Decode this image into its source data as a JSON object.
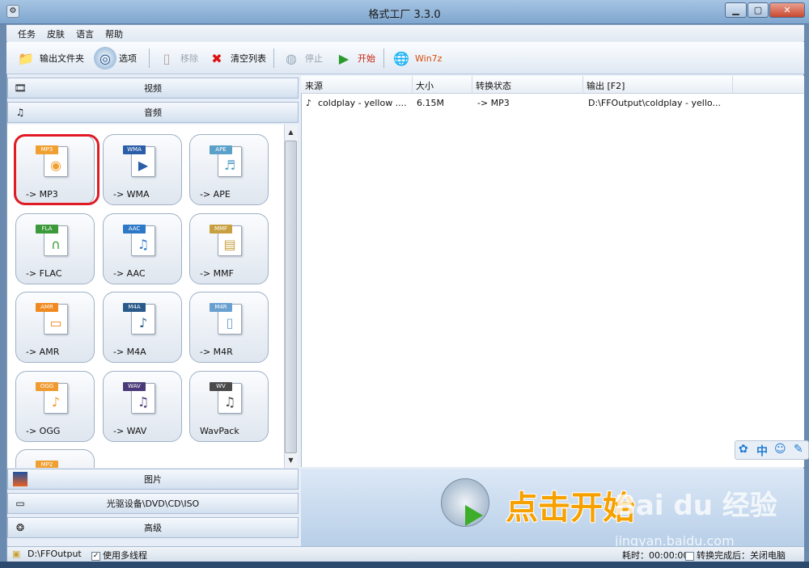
{
  "window": {
    "title": "格式工厂 3.3.0"
  },
  "menu": [
    "任务",
    "皮肤",
    "语言",
    "帮助"
  ],
  "toolbar": {
    "output_folder": "输出文件夹",
    "options": "选项",
    "remove": "移除",
    "clear_list": "清空列表",
    "stop": "停止",
    "start": "开始",
    "win7z": "Win7z"
  },
  "categories": {
    "video": "视频",
    "audio": "音频",
    "picture": "图片",
    "rom": "光驱设备\\DVD\\CD\\ISO",
    "advanced": "高级"
  },
  "formats": [
    {
      "tag": "MP3",
      "label": "-> MP3",
      "color": "#f0a030",
      "symbol": "◉"
    },
    {
      "tag": "WMA",
      "label": "-> WMA",
      "color": "#2a5ea8",
      "symbol": "▶"
    },
    {
      "tag": "APE",
      "label": "-> APE",
      "color": "#5aa0c8",
      "symbol": "♬"
    },
    {
      "tag": "FLA",
      "label": "-> FLAC",
      "color": "#3c9a3a",
      "symbol": "∩"
    },
    {
      "tag": "AAC",
      "label": "-> AAC",
      "color": "#2f78c8",
      "symbol": "♫"
    },
    {
      "tag": "MMF",
      "label": "-> MMF",
      "color": "#c8a040",
      "symbol": "▤"
    },
    {
      "tag": "AMR",
      "label": "-> AMR",
      "color": "#f08a20",
      "symbol": "▭"
    },
    {
      "tag": "M4A",
      "label": "-> M4A",
      "color": "#2a5a8a",
      "symbol": "♪"
    },
    {
      "tag": "M4R",
      "label": "-> M4R",
      "color": "#6aa0d0",
      "symbol": "▯"
    },
    {
      "tag": "OGG",
      "label": "-> OGG",
      "color": "#f09a30",
      "symbol": "♪"
    },
    {
      "tag": "WAV",
      "label": "-> WAV",
      "color": "#4a3a7a",
      "symbol": "♫"
    },
    {
      "tag": "WV",
      "label": "WavPack",
      "color": "#4a4a4a",
      "symbol": "♫"
    }
  ],
  "partial_tile_tag": "MP2",
  "table": {
    "headers": [
      "来源",
      "大小",
      "转换状态",
      "输出 [F2]"
    ],
    "rows": [
      {
        "source": "coldplay - yellow ....",
        "size": "6.15M",
        "status": "-> MP3",
        "output": "D:\\FFOutput\\coldplay - yello..."
      }
    ]
  },
  "banner": {
    "text": "点击开始",
    "watermark": "Bai du 经验",
    "watermark_url": "jingyan.baidu.com"
  },
  "ime": {
    "lang": "中"
  },
  "status": {
    "output_path": "D:\\FFOutput",
    "multithread_label": "使用多线程",
    "elapsed_label": "耗时：00:00:00",
    "after_done_label": "转换完成后：关闭电脑"
  }
}
